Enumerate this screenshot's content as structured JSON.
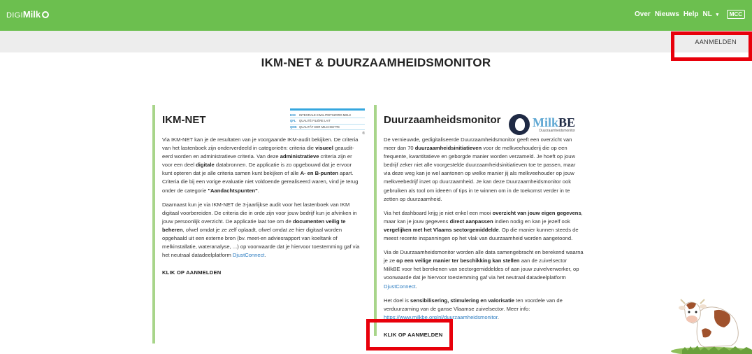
{
  "header": {
    "logo_digi": "DIGI",
    "logo_milk": "Milk",
    "nav": [
      "Over",
      "Nieuws",
      "Help"
    ],
    "language": "NL",
    "mcc_label": "MCC"
  },
  "subbar": {
    "login_label": "AANMELDEN"
  },
  "page": {
    "title": "IKM-NET & DUURZAAMHEIDSMONITOR"
  },
  "left": {
    "title": "IKM-NET",
    "logo_rows": [
      {
        "code": "IKM",
        "text": "INTEGRALE KWALITEITSZORG MELK"
      },
      {
        "code": "QFL",
        "text": "QUALITÉ FILIÈRE LAIT"
      },
      {
        "code": "QMK",
        "text": "QUALITÄT DER MILCHKETTE"
      }
    ],
    "p1": [
      {
        "t": "Via IKM-NET kan je de resultaten van je voorgaande IKM-audit bekijken. De criteria van het lastenboek zijn onderverdeeld in categorieën: criteria die "
      },
      {
        "t": "visueel",
        "b": true
      },
      {
        "t": " geaudit­eerd worden en administratieve criteria. Van deze "
      },
      {
        "t": "administratieve",
        "b": true
      },
      {
        "t": " criteria zijn er voor een deel "
      },
      {
        "t": "digitale",
        "b": true
      },
      {
        "t": " databronnen. De applicatie is zo opgebouwd dat je ervoor kunt opteren dat je alle criteria samen kunt bekijken of alle "
      },
      {
        "t": "A- en B-punten",
        "b": true
      },
      {
        "t": " apart. Criteria die bij een vorige evaluatie niet voldoende gerealiseerd waren, vind je terug onder de categorie "
      },
      {
        "t": "\"Aandachtspunten\"",
        "b": true
      },
      {
        "t": "."
      }
    ],
    "p2": [
      {
        "t": "Daarnaast kun je via IKM-NET de 3-jaarlijkse audit voor het lastenboek van IKM digitaal voorbereiden. De criteria die in orde zijn voor jouw bedrijf kun je afvinken in jouw persoonlijk overzicht. De applicatie laat toe om de "
      },
      {
        "t": "documenten veilig te beheren",
        "b": true
      },
      {
        "t": ", ofwel omdat je ze zelf oplaadt, ofwel omdat ze hier digitaal worden opgehaald uit een externe bron (bv. meet-en adviesrapport van koeltank of melkinstallatie, wateranalyse, ...) op voorwaarde dat je hiervoor toestemming gaf via het neutraal datadeelplatform "
      },
      {
        "t": "DjustConnect",
        "link": true
      },
      {
        "t": "."
      }
    ],
    "cta": "KLIK OP AANMELDEN"
  },
  "right": {
    "title": "Duurzaamheidsmonitor",
    "logo_brand_1": "Milk",
    "logo_brand_2": "BE",
    "logo_sub": "Duurzaamheidsmonitor",
    "p1": [
      {
        "t": "De vernieuwde, gedigitaliseerde Duurzaamheidsmonitor geeft een overzicht van meer dan 70 "
      },
      {
        "t": "duurzaamheidsinitiatieven",
        "b": true
      },
      {
        "t": " voor de melkveehouderij die op een frequente, kwantitatieve en geborgde manier worden verzameld. Je hoeft op jouw bedrijf zeker niet alle voorgestelde duurzaamheidsinitiatieven toe te passen, maar via deze weg kan je wel aantonen op welke manier jij als melkveehouder op jouw melkveebedrijf inzet op duurzaamheid. Je kan deze Duurzaamheidsmonitor ook gebruiken als tool om ideeën of tips in te winnen om in de toekomst verder in te zetten op duurzaamheid."
      }
    ],
    "p2": [
      {
        "t": "Via het dashboard krijg je niet enkel een mooi "
      },
      {
        "t": "overzicht van jouw eigen gegevens",
        "b": true
      },
      {
        "t": ", maar kan je jouw gegevens "
      },
      {
        "t": "direct aanpassen",
        "b": true
      },
      {
        "t": " indien nodig en kan je jezelf ook "
      },
      {
        "t": "vergelijken met het Vlaams sectorgemiddelde",
        "b": true
      },
      {
        "t": ". Op die manier kunnen steeds de meest recente inspanningen op het vlak van duurzaamheid worden aangetoond."
      }
    ],
    "p3": [
      {
        "t": "Via de Duurzaamheidsmonitor worden alle data samengebracht en berekend waarna je ze "
      },
      {
        "t": "op een veilige manier ter beschikking kan stellen",
        "b": true
      },
      {
        "t": " aan de zuivelsector MilkBE voor het berekenen van sectorgemiddeldes of aan jouw zuivelverwerker, op voorwaarde dat je hiervoor toestemming gaf via het neutraal datadeelplatform "
      },
      {
        "t": "DjustConnect",
        "link": true
      },
      {
        "t": "."
      }
    ],
    "p4": [
      {
        "t": "Het doel is "
      },
      {
        "t": "sensibilisering, stimulering en valorisatie",
        "b": true
      },
      {
        "t": " ten voordele van de verduurzaming van de ganse Vlaamse zuivelsector. Meer info: "
      },
      {
        "t": "https://www.milkbe.org/nl/duurzaamheidsmonitor",
        "link": true
      },
      {
        "t": "."
      }
    ],
    "cta": "KLIK OP AANMELDEN"
  },
  "colors": {
    "header_green": "#6cbf4f",
    "column_border": "#a8d58a",
    "link_blue": "#2a7bc0",
    "highlight_red": "#e8000b"
  }
}
